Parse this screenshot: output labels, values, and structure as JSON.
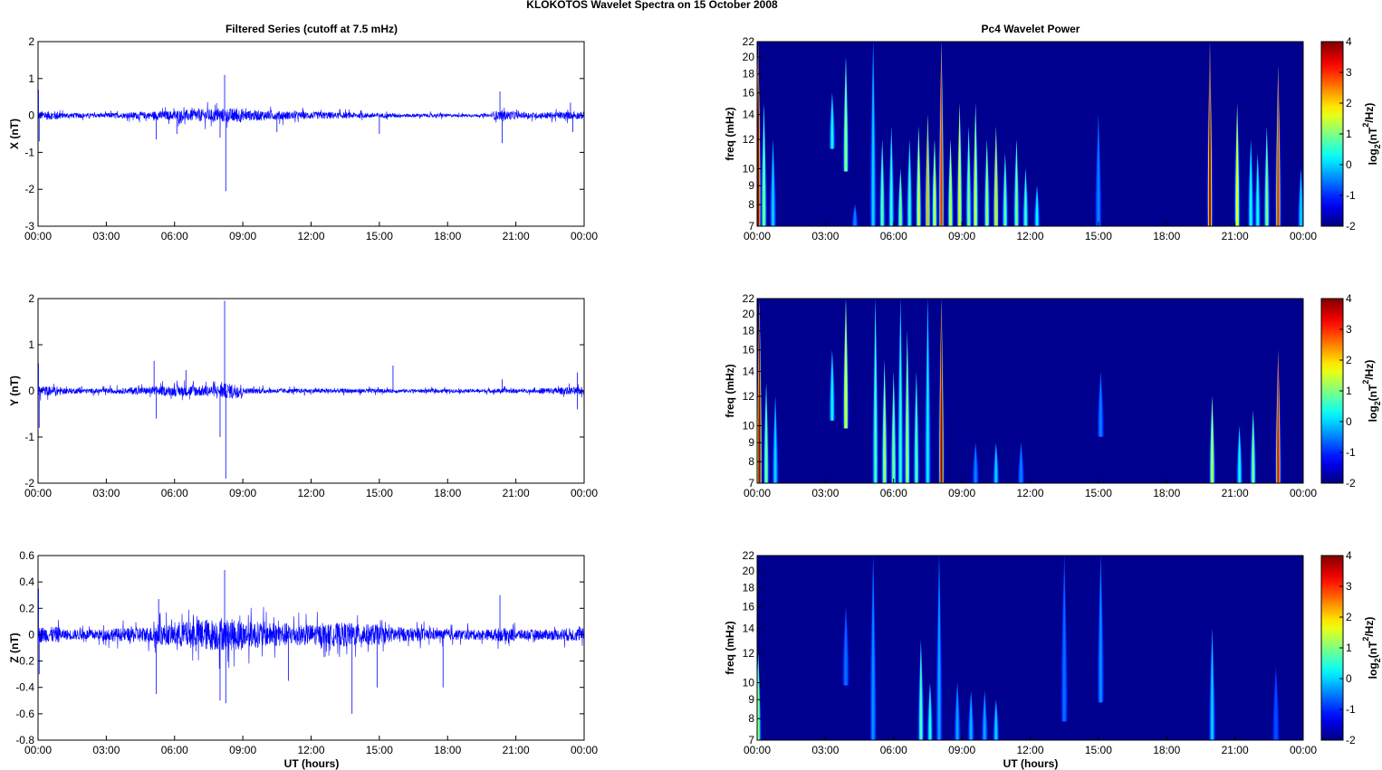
{
  "figure_title": "KLOKOTOS Wavelet Spectra on 15 October   2008",
  "chart_data": {
    "type": "line+heatmap",
    "left_title": "Filtered Series (cutoff at 7.5 mHz)",
    "right_title": "Pc4 Wavelet Power",
    "xlabel": "UT (hours)",
    "xticks": [
      "00:00",
      "03:00",
      "06:00",
      "09:00",
      "12:00",
      "15:00",
      "18:00",
      "21:00",
      "00:00"
    ],
    "xlim": [
      0,
      24
    ],
    "freq_label": "freq (mHz)",
    "freq_ticks": [
      7,
      8,
      9,
      10,
      12,
      14,
      16,
      18,
      20,
      22
    ],
    "freq_lim": [
      7,
      22
    ],
    "colorbar_label_base": "log",
    "colorbar_label_sub": "2",
    "colorbar_label_unit": "(nT",
    "colorbar_label_sup": "2",
    "colorbar_label_end": "/Hz)",
    "clim": [
      -2,
      4
    ],
    "colorbar_ticks": [
      -2,
      -1,
      0,
      1,
      2,
      3,
      4
    ],
    "series": [
      {
        "name": "X",
        "ylabel": "X (nT)",
        "ylim": [
          -3,
          2
        ],
        "yticks": [
          -3,
          -2,
          -1,
          0,
          1,
          2
        ],
        "envelope": [
          0.12,
          0.07,
          0.06,
          0.07,
          0.09,
          0.12,
          0.15,
          0.17,
          0.19,
          0.14,
          0.12,
          0.1,
          0.1,
          0.08,
          0.07,
          0.06,
          0.05,
          0.05,
          0.04,
          0.04,
          0.12,
          0.08,
          0.09,
          0.1
        ],
        "spikes": [
          [
            0.02,
            0.7
          ],
          [
            0.05,
            -0.7
          ],
          [
            5.2,
            -0.65
          ],
          [
            6.1,
            -0.5
          ],
          [
            8.2,
            1.1
          ],
          [
            8.25,
            -2.05
          ],
          [
            8.0,
            -0.6
          ],
          [
            10.5,
            -0.45
          ],
          [
            15.0,
            -0.5
          ],
          [
            20.3,
            0.65
          ],
          [
            20.4,
            -0.75
          ],
          [
            23.4,
            0.35
          ],
          [
            23.5,
            -0.45
          ]
        ],
        "wavelet": [
          [
            0.05,
            7,
            22,
            3.8
          ],
          [
            0.3,
            7,
            15,
            1
          ],
          [
            0.7,
            7,
            12,
            0
          ],
          [
            3.3,
            11.5,
            16,
            0.3
          ],
          [
            3.9,
            10,
            20,
            1.2
          ],
          [
            4.3,
            7,
            8,
            -0.5
          ],
          [
            5.1,
            7,
            22,
            0
          ],
          [
            5.5,
            7,
            12,
            0.8
          ],
          [
            5.9,
            7,
            13,
            0.5
          ],
          [
            6.3,
            7,
            10,
            1
          ],
          [
            6.7,
            7,
            12,
            0.6
          ],
          [
            7.1,
            7,
            13,
            1.6
          ],
          [
            7.5,
            7,
            14,
            2.2
          ],
          [
            7.8,
            7,
            12,
            1.5
          ],
          [
            8.1,
            7,
            22,
            3
          ],
          [
            8.5,
            7,
            12,
            1.5
          ],
          [
            8.9,
            7,
            15,
            1.8
          ],
          [
            9.3,
            7,
            13,
            1
          ],
          [
            9.6,
            7,
            15,
            1.5
          ],
          [
            10.1,
            7,
            12,
            1.2
          ],
          [
            10.5,
            7,
            13,
            2
          ],
          [
            10.9,
            7,
            11,
            0.8
          ],
          [
            11.4,
            7,
            12,
            1
          ],
          [
            11.8,
            7,
            10,
            0.6
          ],
          [
            12.3,
            7,
            9,
            0.2
          ],
          [
            15.0,
            7,
            14,
            -0.5
          ],
          [
            19.9,
            7,
            22,
            3.6
          ],
          [
            21.1,
            7,
            15,
            1.8
          ],
          [
            21.7,
            7,
            12,
            0.3
          ],
          [
            22.0,
            7,
            11,
            0.3
          ],
          [
            22.4,
            7,
            13,
            1
          ],
          [
            22.9,
            7,
            19,
            3
          ],
          [
            23.9,
            7,
            10,
            0
          ]
        ]
      },
      {
        "name": "Y",
        "ylabel": "Y (nT)",
        "ylim": [
          -2,
          2
        ],
        "yticks": [
          -2,
          -1,
          0,
          1,
          2
        ],
        "envelope": [
          0.1,
          0.06,
          0.05,
          0.06,
          0.08,
          0.1,
          0.12,
          0.12,
          0.16,
          0.06,
          0.05,
          0.05,
          0.05,
          0.05,
          0.05,
          0.04,
          0.04,
          0.04,
          0.04,
          0.04,
          0.05,
          0.04,
          0.07,
          0.08
        ],
        "spikes": [
          [
            0.02,
            0.6
          ],
          [
            0.05,
            -0.8
          ],
          [
            5.1,
            0.65
          ],
          [
            5.2,
            -0.6
          ],
          [
            6.5,
            0.45
          ],
          [
            8.2,
            1.95
          ],
          [
            8.25,
            -1.9
          ],
          [
            8.0,
            -1.0
          ],
          [
            15.6,
            0.55
          ],
          [
            20.4,
            0.25
          ],
          [
            23.7,
            0.4
          ],
          [
            23.7,
            -0.4
          ]
        ],
        "wavelet": [
          [
            0.1,
            7,
            22,
            3.8
          ],
          [
            0.4,
            7,
            13,
            1
          ],
          [
            0.8,
            7,
            12,
            0
          ],
          [
            3.3,
            10.5,
            16,
            0.3
          ],
          [
            3.9,
            10,
            22,
            1.8
          ],
          [
            5.2,
            7,
            22,
            0.7
          ],
          [
            5.6,
            7,
            15,
            1.3
          ],
          [
            6.0,
            7,
            14,
            1
          ],
          [
            6.3,
            7,
            22,
            0.5
          ],
          [
            6.6,
            7,
            18,
            1.2
          ],
          [
            7.0,
            7,
            14,
            0.7
          ],
          [
            7.5,
            7,
            22,
            0.2
          ],
          [
            8.1,
            7,
            22,
            3.8
          ],
          [
            9.6,
            7,
            9,
            -0.5
          ],
          [
            10.5,
            7,
            9,
            0
          ],
          [
            11.6,
            7,
            9,
            -0.5
          ],
          [
            15.1,
            9.5,
            14,
            -0.5
          ],
          [
            20.0,
            7,
            12,
            1.5
          ],
          [
            21.2,
            7,
            10,
            0.3
          ],
          [
            21.8,
            7,
            11,
            1
          ],
          [
            22.9,
            7,
            16,
            3.2
          ]
        ]
      },
      {
        "name": "Z",
        "ylabel": "Z (nT)",
        "ylim": [
          -0.8,
          0.6
        ],
        "yticks": [
          -0.8,
          -0.6,
          -0.4,
          -0.2,
          0,
          0.2,
          0.4,
          0.6
        ],
        "envelope": [
          0.06,
          0.04,
          0.04,
          0.05,
          0.06,
          0.08,
          0.1,
          0.12,
          0.12,
          0.1,
          0.09,
          0.08,
          0.08,
          0.09,
          0.08,
          0.06,
          0.05,
          0.04,
          0.04,
          0.04,
          0.05,
          0.04,
          0.04,
          0.05
        ],
        "spikes": [
          [
            0.02,
            0.35
          ],
          [
            0.05,
            -0.3
          ],
          [
            5.2,
            -0.45
          ],
          [
            5.3,
            0.27
          ],
          [
            8.2,
            0.49
          ],
          [
            8.25,
            -0.52
          ],
          [
            8.0,
            -0.5
          ],
          [
            13.8,
            -0.6
          ],
          [
            11.0,
            -0.35
          ],
          [
            14.9,
            -0.4
          ],
          [
            17.8,
            -0.4
          ],
          [
            20.3,
            0.3
          ]
        ],
        "wavelet": [
          [
            0.05,
            7,
            12,
            1.2
          ],
          [
            3.9,
            10,
            16,
            -0.6
          ],
          [
            5.1,
            7,
            22,
            -0.4
          ],
          [
            7.2,
            7,
            13,
            0.7
          ],
          [
            7.6,
            7,
            10,
            0.4
          ],
          [
            8.0,
            7,
            22,
            -0.3
          ],
          [
            8.8,
            7,
            10,
            -0.3
          ],
          [
            9.4,
            7,
            9.5,
            -0.2
          ],
          [
            10.0,
            7,
            9.5,
            -0.3
          ],
          [
            10.5,
            7,
            9,
            0
          ],
          [
            13.5,
            8,
            22,
            -0.6
          ],
          [
            15.1,
            9,
            22,
            -0.4
          ],
          [
            20.0,
            7,
            14,
            0
          ],
          [
            22.8,
            7,
            11,
            -0.8
          ]
        ]
      }
    ]
  }
}
